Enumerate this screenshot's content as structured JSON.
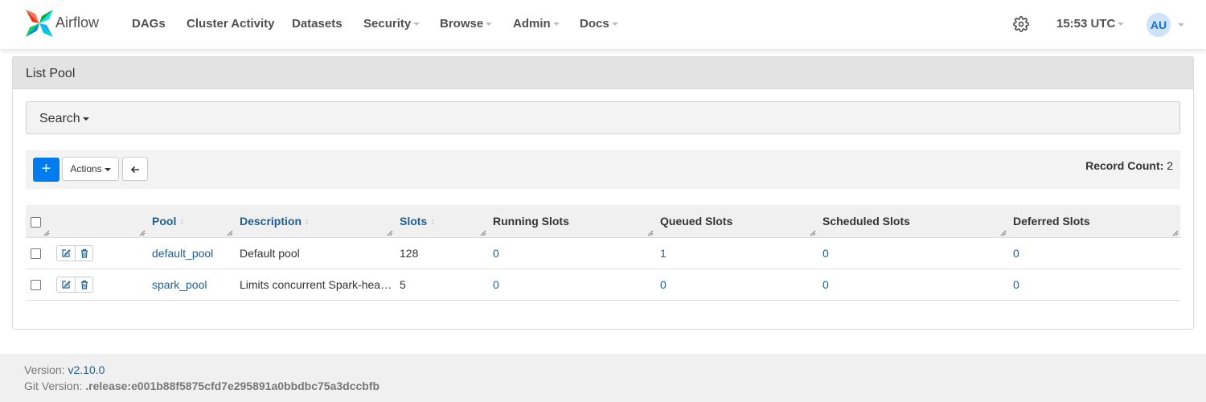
{
  "brand": {
    "name": "Airflow",
    "colors": {
      "blue": "#017cee",
      "teal": "#00ad46",
      "red": "#e43921",
      "navy": "#0cb6ff"
    }
  },
  "nav": {
    "items": [
      {
        "label": "DAGs",
        "dropdown": false
      },
      {
        "label": "Cluster Activity",
        "dropdown": false
      },
      {
        "label": "Datasets",
        "dropdown": false
      },
      {
        "label": "Security",
        "dropdown": true
      },
      {
        "label": "Browse",
        "dropdown": true
      },
      {
        "label": "Admin",
        "dropdown": true
      },
      {
        "label": "Docs",
        "dropdown": true
      }
    ],
    "time": "15:53 UTC",
    "user_initials": "AU",
    "settings_icon": "gear-icon"
  },
  "panel": {
    "title": "List Pool"
  },
  "search": {
    "label": "Search"
  },
  "toolbar": {
    "add_icon": "+",
    "actions_label": "Actions",
    "back_icon": "arrow-left-icon",
    "record_count_label": "Record Count:",
    "record_count_value": "2"
  },
  "table": {
    "columns": [
      {
        "label": "Pool",
        "sortable": true
      },
      {
        "label": "Description",
        "sortable": true
      },
      {
        "label": "Slots",
        "sortable": true
      },
      {
        "label": "Running Slots",
        "sortable": false
      },
      {
        "label": "Queued Slots",
        "sortable": false
      },
      {
        "label": "Scheduled Slots",
        "sortable": false
      },
      {
        "label": "Deferred Slots",
        "sortable": false
      }
    ],
    "rows": [
      {
        "pool": "default_pool",
        "description": "Default pool",
        "slots": "128",
        "running": "0",
        "queued": "1",
        "scheduled": "0",
        "deferred": "0"
      },
      {
        "pool": "spark_pool",
        "description": "Limits concurrent Spark-heavy tasks",
        "slots": "5",
        "running": "0",
        "queued": "0",
        "scheduled": "0",
        "deferred": "0"
      }
    ]
  },
  "footer": {
    "version_label": "Version:",
    "version_value": "v2.10.0",
    "git_label": "Git Version:",
    "git_value": ".release:e001b88f5875cfd7e295891a0bbdbc75a3dccbfb"
  }
}
